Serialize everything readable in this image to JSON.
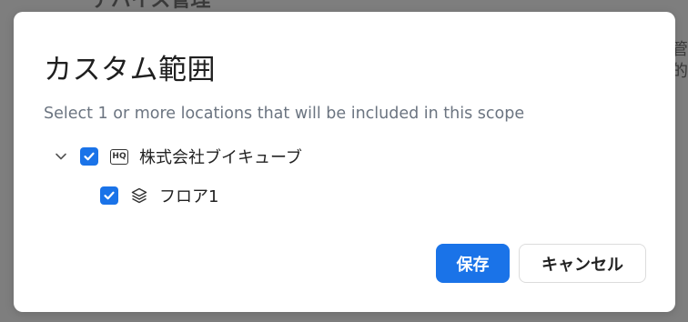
{
  "background": {
    "heading": "デバイス管理",
    "side_text_1": "管理",
    "side_text_2": "的"
  },
  "modal": {
    "title": "カスタム範囲",
    "description": "Select 1 or more locations that will be included in this scope",
    "tree": [
      {
        "label": "株式会社ブイキューブ",
        "icon": "hq-icon",
        "checked": true,
        "expanded": true
      },
      {
        "label": "フロア1",
        "icon": "layers-icon",
        "checked": true
      }
    ],
    "hq_icon_text": "HQ",
    "buttons": {
      "save_label": "保存",
      "cancel_label": "キャンセル"
    }
  },
  "colors": {
    "primary": "#1a73e8",
    "overlay": "#7e7e7e",
    "description_text": "#6b7480"
  }
}
